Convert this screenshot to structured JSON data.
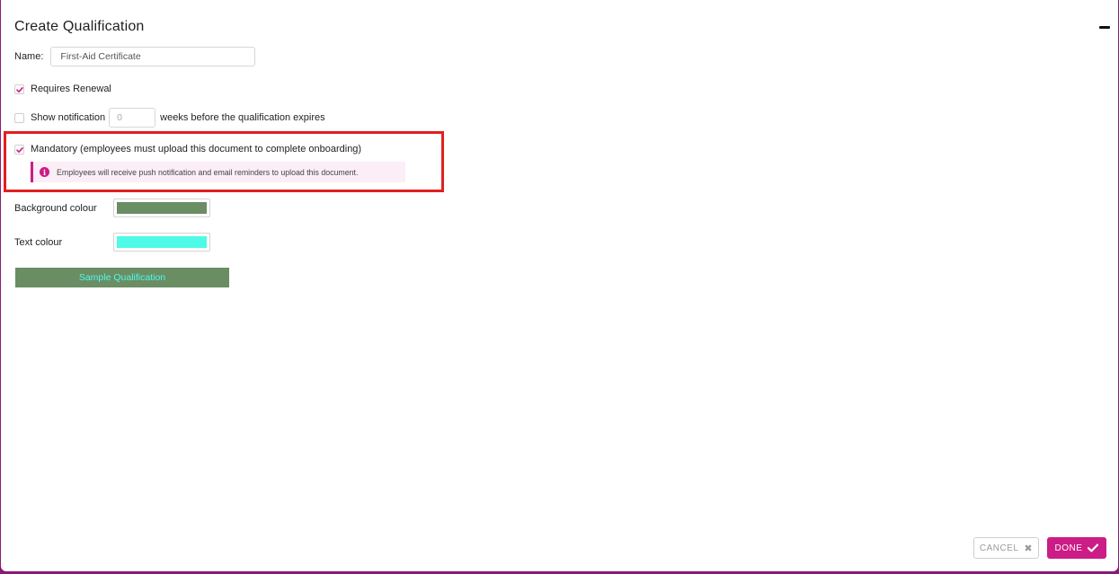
{
  "dialog": {
    "title": "Create Qualification"
  },
  "name_field": {
    "label": "Name:",
    "value": "First-Aid Certificate"
  },
  "requires_renewal": {
    "label": "Requires Renewal",
    "checked": true
  },
  "show_notification": {
    "label": "Show notification",
    "checked": false,
    "weeks_placeholder": "0",
    "suffix": "weeks before the qualification expires"
  },
  "mandatory": {
    "label": "Mandatory (employees must upload this document to complete onboarding)",
    "checked": true,
    "info_text": "Employees will receive push notification and email reminders to upload this document."
  },
  "background_colour": {
    "label": "Background colour",
    "value": "#6a8d64"
  },
  "text_colour": {
    "label": "Text colour",
    "value": "#4dfbe6"
  },
  "sample": {
    "label": "Sample Qualification"
  },
  "footer": {
    "cancel_label": "CANCEL",
    "done_label": "DONE"
  },
  "colors": {
    "accent": "#cc1c86",
    "highlight": "#e02020",
    "backdrop": "#8a1a74"
  },
  "icons": {
    "minimize": "minimize-icon",
    "checkmark": "checkmark-icon",
    "info": "info-icon",
    "close": "close-icon"
  }
}
